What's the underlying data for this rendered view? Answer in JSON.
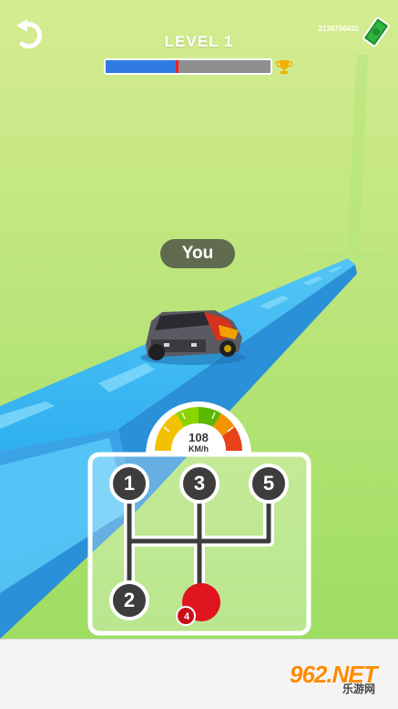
{
  "hud": {
    "level_label": "LEVEL 1",
    "money": "2130706432",
    "progress_fraction": 0.43
  },
  "player": {
    "tag": "You"
  },
  "speedometer": {
    "value": "108",
    "unit": "KM/h"
  },
  "gearbox": {
    "gears": [
      "1",
      "2",
      "3",
      "4",
      "5"
    ],
    "current_gear": "4"
  },
  "watermark": {
    "brand": "962.NET",
    "sub": "乐游网"
  },
  "colors": {
    "sky_top": "#cbe98a",
    "sky_bottom": "#a9e06a",
    "track": "#3db2ef",
    "progress_fill": "#2f7be3",
    "gear_active": "#e0141e"
  }
}
